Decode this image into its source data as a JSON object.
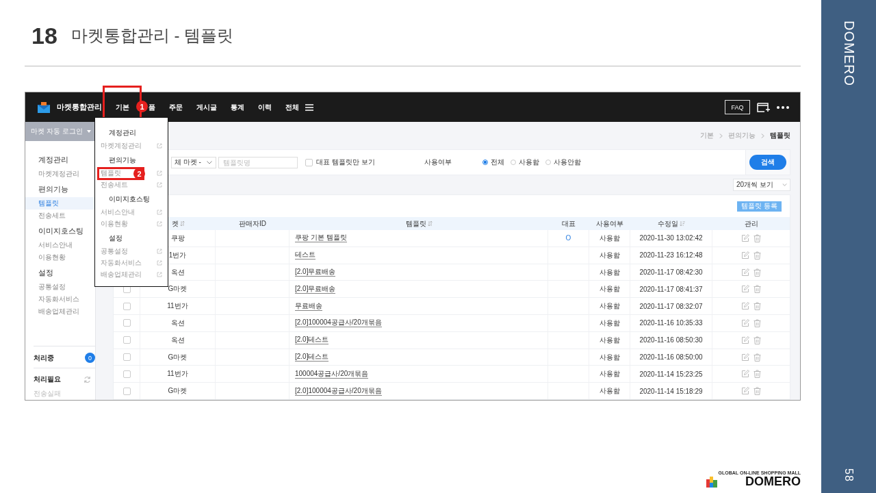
{
  "slide": {
    "number": "18",
    "title": "마켓통합관리 - 템플릿",
    "brand": "DOMERO",
    "page": "58"
  },
  "logo": {
    "tagline": "GLOBAL ON-LINE SHOPPING MALL",
    "name": "DOMERO"
  },
  "app": {
    "title": "마켓통합관리",
    "nav": [
      {
        "label": "기본",
        "annotation": "1"
      },
      {
        "label": "품"
      },
      {
        "label": "주문"
      },
      {
        "label": "게시글"
      },
      {
        "label": "통계"
      },
      {
        "label": "이력"
      },
      {
        "label": "전체",
        "kind": "menu"
      }
    ],
    "faq": "FAQ",
    "dropdown": [
      {
        "title": "계정관리",
        "items": [
          {
            "label": "마켓계정관리"
          }
        ]
      },
      {
        "title": "편의기능",
        "items": [
          {
            "label": "템플릿",
            "annotation": "2"
          },
          {
            "label": "전송세트"
          }
        ]
      },
      {
        "title": "이미지호스팅",
        "items": [
          {
            "label": "서비스안내"
          },
          {
            "label": "이용현황"
          }
        ]
      },
      {
        "title": "설정",
        "items": [
          {
            "label": "공통설정"
          },
          {
            "label": "자동화서비스"
          },
          {
            "label": "배송업체관리"
          }
        ]
      }
    ],
    "sidebar": {
      "login": "마켓 자동 로그인",
      "groups": [
        {
          "title": "계정관리",
          "items": [
            {
              "label": "마켓계정관리",
              "selected": false
            }
          ]
        },
        {
          "title": "편의기능",
          "items": [
            {
              "label": "템플릿",
              "selected": true
            },
            {
              "label": "전송세트",
              "selected": false
            }
          ]
        },
        {
          "title": "이미지호스팅",
          "items": [
            {
              "label": "서비스안내",
              "selected": false
            },
            {
              "label": "이용현황",
              "selected": false
            }
          ]
        },
        {
          "title": "설정",
          "items": [
            {
              "label": "공통설정",
              "selected": false
            },
            {
              "label": "자동화서비스",
              "selected": false
            },
            {
              "label": "배송업체관리",
              "selected": false
            }
          ]
        }
      ],
      "status": [
        {
          "label": "처리중",
          "kind": "count",
          "count": "0"
        },
        {
          "label": "처리필요",
          "kind": "refresh",
          "sub": "전송실패"
        }
      ]
    },
    "breadcrumb": [
      "기본",
      "편의기능",
      "템플릿"
    ],
    "filters": {
      "market": "체 마켓 -",
      "name_placeholder": "템플릿명",
      "only_main": {
        "label": "대표 템플릿만 보기",
        "checked": false
      },
      "usage_label": "사용여부",
      "usage_options": [
        {
          "label": "전체",
          "selected": true
        },
        {
          "label": "사용함",
          "selected": false
        },
        {
          "label": "사용안함",
          "selected": false
        }
      ],
      "search": "검색"
    },
    "page_size": "20개씩 보기",
    "register": "템플릿 등록",
    "table": {
      "columns": [
        {
          "label": "켓",
          "kind": "sortable"
        },
        {
          "label": "판매자ID",
          "kind": "plain"
        },
        {
          "label": "템플릿",
          "kind": "sortable"
        },
        {
          "label": "대표",
          "kind": "plain"
        },
        {
          "label": "사용여부",
          "kind": "plain"
        },
        {
          "label": "수정일",
          "kind": "sorted"
        },
        {
          "label": "관리",
          "kind": "plain"
        }
      ],
      "rows": [
        {
          "market": "쿠팡",
          "template": "쿠팡 기본 템플릿",
          "main": "O",
          "usage": "사용함",
          "modified": "2020-11-30 13:02:42"
        },
        {
          "market": "1번가",
          "template": "테스트",
          "usage": "사용함",
          "modified": "2020-11-23 16:12:48"
        },
        {
          "market": "옥션",
          "template": "[2.0]무료배송",
          "usage": "사용함",
          "modified": "2020-11-17 08:42:30"
        },
        {
          "market": "G마켓",
          "template": "[2.0]무료배송",
          "usage": "사용함",
          "modified": "2020-11-17 08:41:37",
          "checked": false
        },
        {
          "market": "11번가",
          "template": "무료배송",
          "usage": "사용함",
          "modified": "2020-11-17 08:32:07",
          "checked": false
        },
        {
          "market": "옥션",
          "template": "[2.0]100004공급사/20개묶음",
          "usage": "사용함",
          "modified": "2020-11-16 10:35:33",
          "checked": false
        },
        {
          "market": "옥션",
          "template": "[2.0]테스트",
          "usage": "사용함",
          "modified": "2020-11-16 08:50:30",
          "checked": false
        },
        {
          "market": "G마켓",
          "template": "[2.0]테스트",
          "usage": "사용함",
          "modified": "2020-11-16 08:50:00",
          "checked": false
        },
        {
          "market": "11번가",
          "template": "100004공급사/20개묶음",
          "usage": "사용함",
          "modified": "2020-11-14 15:23:25",
          "checked": false
        },
        {
          "market": "G마켓",
          "template": "[2.0]100004공급사/20개묶음",
          "usage": "사용함",
          "modified": "2020-11-14 15:18:29",
          "checked": false
        }
      ]
    }
  }
}
